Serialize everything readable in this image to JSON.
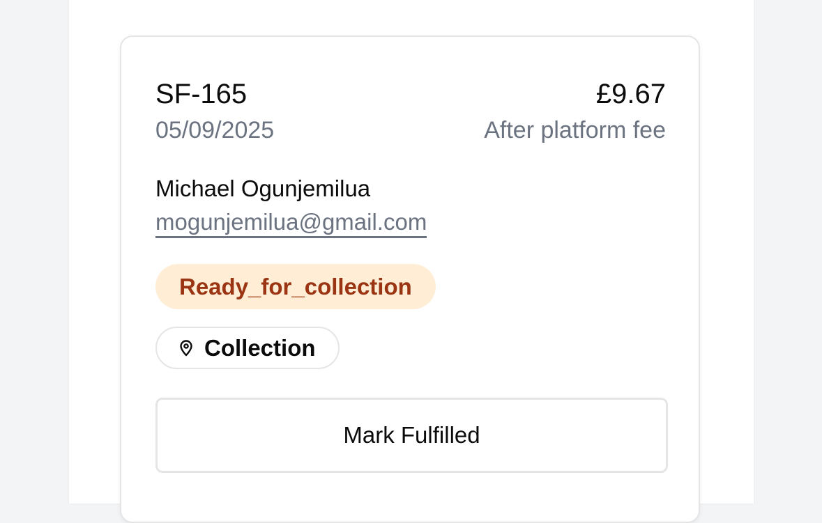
{
  "order": {
    "id": "SF-165",
    "date": "05/09/2025",
    "amount": "£9.67",
    "fee_note": "After platform fee",
    "customer": {
      "name": "Michael Ogunjemilua",
      "email": "mogunjemilua@gmail.com"
    },
    "status": {
      "label": "Ready_for_collection",
      "background": "#ffedd5",
      "color": "#9a3412"
    },
    "fulfillment_method": {
      "icon": "map-pin-icon",
      "label": "Collection"
    },
    "actions": {
      "mark_fulfilled_label": "Mark Fulfilled"
    }
  }
}
